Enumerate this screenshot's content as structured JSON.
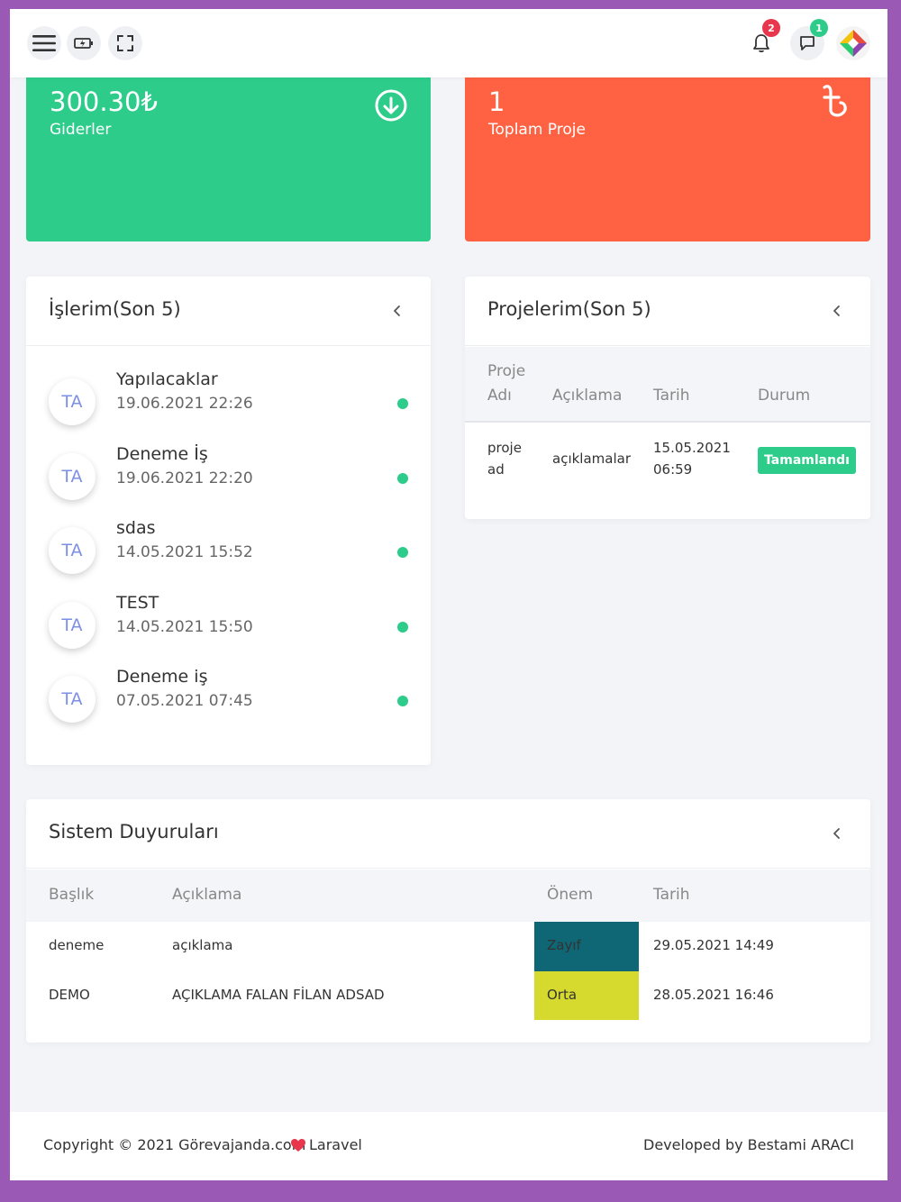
{
  "header": {
    "notifications_count": "2",
    "messages_count": "1",
    "colors": {
      "notification_badge": "#e8364d",
      "message_badge": "#2ecc8b"
    }
  },
  "stats": [
    {
      "value": "300.30₺",
      "label": "Giderler",
      "color": "#2ecc8b",
      "icon": "arrow-down-circle-icon"
    },
    {
      "value": "1",
      "label": "Toplam Proje",
      "color": "#fe6243",
      "icon": "taka-icon"
    }
  ],
  "jobs_card": {
    "title": "İşlerim(Son 5)",
    "items": [
      {
        "initials": "TA",
        "name": "Yapılacaklar",
        "date": "19.06.2021 22:26"
      },
      {
        "initials": "TA",
        "name": "Deneme İş",
        "date": "19.06.2021 22:20"
      },
      {
        "initials": "TA",
        "name": "sdas",
        "date": "14.05.2021 15:52"
      },
      {
        "initials": "TA",
        "name": "TEST",
        "date": "14.05.2021 15:50"
      },
      {
        "initials": "TA",
        "name": "Deneme iş",
        "date": "07.05.2021 07:45"
      }
    ]
  },
  "projects_card": {
    "title": "Projelerim(Son 5)",
    "columns": [
      "Proje Adı",
      "Açıklama",
      "Tarih",
      "Durum"
    ],
    "rows": [
      {
        "name": "proje ad",
        "desc": "açıklamalar",
        "date": "15.05.2021 06:59",
        "status": "Tamamlandı"
      }
    ]
  },
  "announcements_card": {
    "title": "Sistem Duyuruları",
    "columns": [
      "Başlık",
      "Açıklama",
      "Önem",
      "Tarih"
    ],
    "rows": [
      {
        "title": "deneme",
        "desc": "açıklama",
        "level": "Zayıf",
        "level_color": "#0f6674",
        "date": "29.05.2021 14:49"
      },
      {
        "title": "DEMO",
        "desc": "AÇIKLAMA FALAN FİLAN ADSAD",
        "level": "Orta",
        "level_color": "#d6d92e",
        "date": "28.05.2021 16:46"
      }
    ]
  },
  "footer": {
    "copyright": "Copyright © 2021 Görevajanda.com",
    "framework": "Laravel",
    "developer": "Developed by Bestami ARACI"
  }
}
